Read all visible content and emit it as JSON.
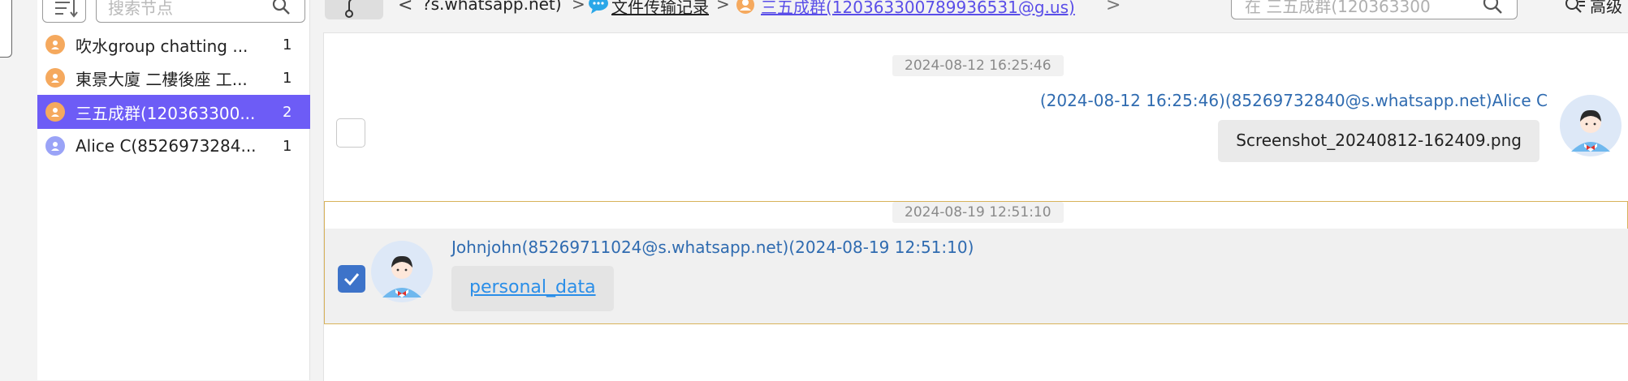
{
  "sidebar": {
    "search_placeholder": "搜索节点",
    "nodes": [
      {
        "label": "吹水group chatting ...",
        "count": "1",
        "type": "group"
      },
      {
        "label": "東景大廈 二樓後座 工...",
        "count": "1",
        "type": "group"
      },
      {
        "label": "三五成群(120363300...",
        "count": "2",
        "type": "group",
        "selected": true
      },
      {
        "label": "Alice C(8526973284...",
        "count": "1",
        "type": "person"
      }
    ]
  },
  "breadcrumb": {
    "items": [
      "?s.whatsapp.net)",
      "文件传输记录",
      "三五成群(120363300789936531@g.us)"
    ],
    "separator": ">"
  },
  "toolbar": {
    "find_placeholder": "在 三五成群(120363300",
    "advanced_label": "高级"
  },
  "messages": [
    {
      "timestamp": "2024-08-12 16:25:46",
      "header": "(2024-08-12 16:25:46)(85269732840@s.whatsapp.net)Alice C",
      "content": "Screenshot_20240812-162409.png",
      "checked": false,
      "side": "right"
    },
    {
      "timestamp": "2024-08-19 12:51:10",
      "header": "Johnjohn(85269711024@s.whatsapp.net)(2024-08-19 12:51:10)",
      "content": "personal_data",
      "checked": true,
      "side": "left"
    }
  ],
  "colors": {
    "selected_row": "#6d5cf6",
    "header_text": "#2f6bb0",
    "link": "#2a8ee8",
    "highlight_border": "#d8b25a",
    "checkbox_checked": "#3d73c9"
  }
}
